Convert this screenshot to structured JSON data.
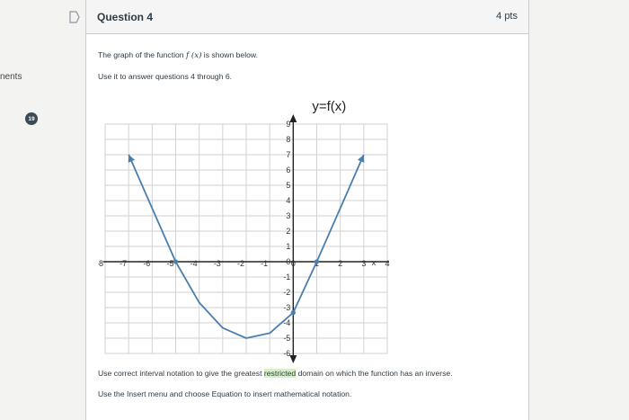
{
  "sidebar": {
    "partial_label": "nents",
    "badge_count": "19"
  },
  "question": {
    "title": "Question 4",
    "points": "4 pts",
    "intro_prefix": "The graph of the function ",
    "intro_math": "f (x)",
    "intro_suffix": " is shown below.",
    "instruction": "Use it to answer questions 4 through 6.",
    "prompt_before": "Use correct interval notation to give the greatest ",
    "prompt_highlight": "restricted",
    "prompt_after": " domain on which the function has an inverse.",
    "hint": "Use the Insert menu and choose Equation to insert mathematical notation."
  },
  "chart_data": {
    "type": "line",
    "title": "y=f(x)",
    "xlabel": "x",
    "ylabel": "",
    "xlim": [
      -8,
      4
    ],
    "ylim": [
      -6,
      9
    ],
    "grid": true,
    "x_ticks": [
      "-8",
      "-7",
      "-6",
      "-5",
      "-4",
      "-3",
      "-2",
      "-1",
      "0",
      "1",
      "2",
      "3",
      "4"
    ],
    "y_ticks": [
      "-6",
      "-5",
      "-4",
      "-3",
      "-2",
      "-1",
      "0",
      "1",
      "2",
      "3",
      "4",
      "5",
      "6",
      "7",
      "8",
      "9"
    ],
    "series": [
      {
        "x": [
          -7,
          -6,
          -5,
          -4,
          -3,
          -2,
          -1,
          0,
          1,
          2,
          3
        ],
        "y": [
          7,
          3.5,
          0,
          -2.67,
          -4.33,
          -5,
          -4.67,
          -3.33,
          0,
          3.5,
          7
        ],
        "color": "#4a7fad",
        "arrows": "both"
      }
    ],
    "points": [
      {
        "x": -5,
        "y": 0
      },
      {
        "x": 1,
        "y": 0
      },
      {
        "x": 0,
        "y": -3.33
      }
    ]
  }
}
